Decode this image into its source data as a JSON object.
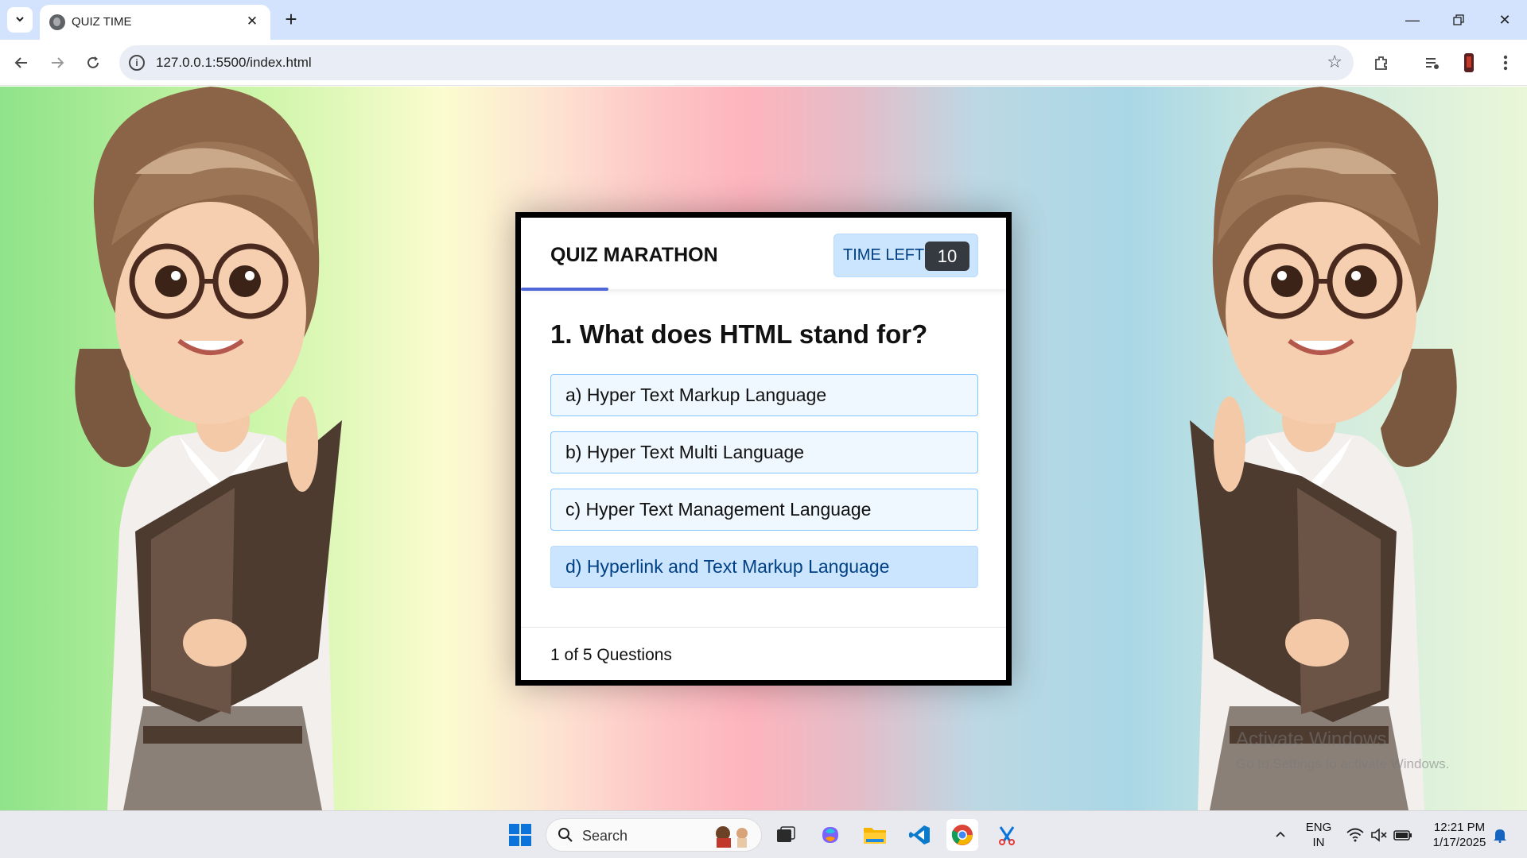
{
  "browser": {
    "tab_title": "QUIZ TIME",
    "url": "127.0.0.1:5500/index.html"
  },
  "quiz": {
    "title": "QUIZ MARATHON",
    "timer_label": "TIME LEFT",
    "timer_value": "10",
    "progress_fraction": 0.18,
    "question": "1. What does HTML stand for?",
    "options": [
      "a) Hyper Text Markup Language",
      "b) Hyper Text Multi Language",
      "c) Hyper Text Management Language",
      "d) Hyperlink and Text Markup Language"
    ],
    "hovered_option": 3,
    "footer": "1 of 5 Questions"
  },
  "watermark": {
    "line1": "Activate Windows",
    "line2": "Go to Settings to activate Windows."
  },
  "taskbar": {
    "search_placeholder": "Search",
    "lang_line1": "ENG",
    "lang_line2": "IN",
    "time": "12:21 PM",
    "date": "1/17/2025"
  },
  "colors": {
    "accent_blue": "#4f66d8",
    "timer_bg": "#cce5ff",
    "timer_badge": "#343a40",
    "option_bg": "#f0f8ff",
    "option_border": "#84c5fe"
  }
}
